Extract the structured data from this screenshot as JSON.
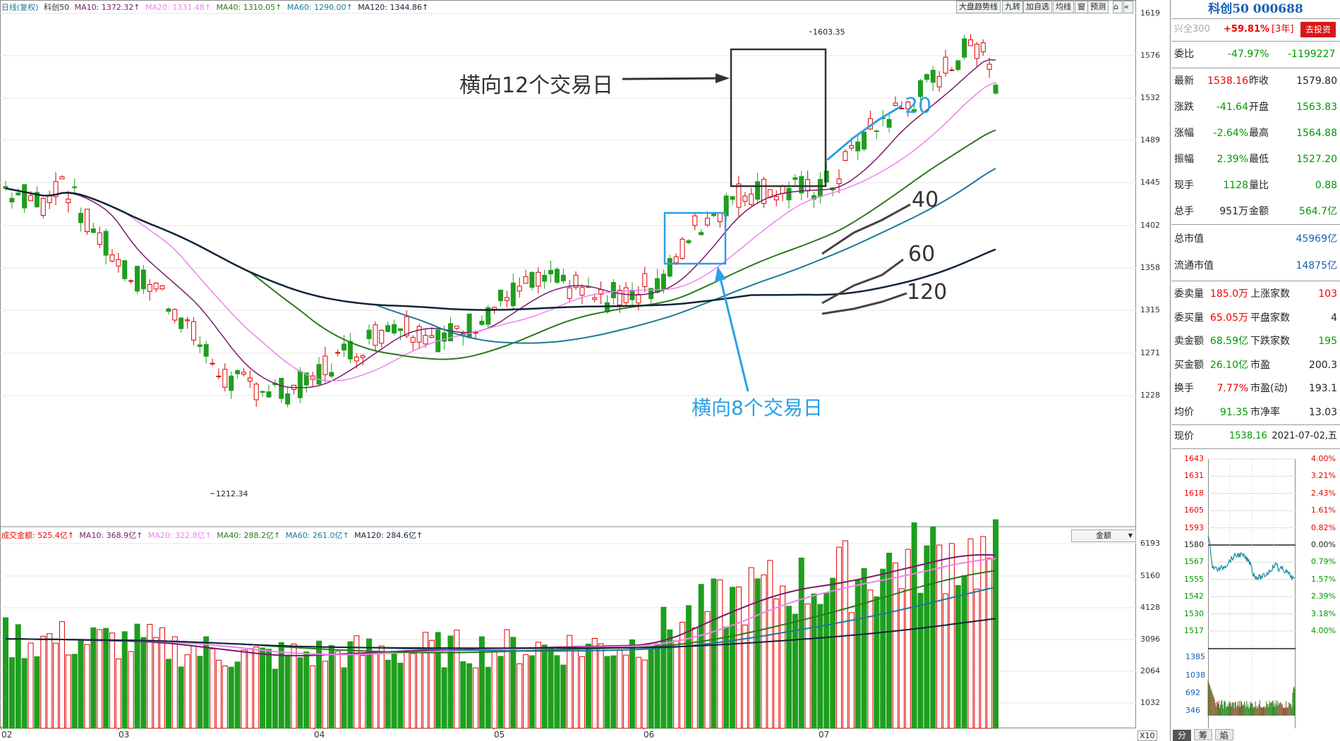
{
  "header_legend": {
    "label_period": "日线(复权)",
    "label_name": "科创50",
    "ma10": "MA10: 1372.32↑",
    "ma20": "MA20: 1331.48↑",
    "ma40": "MA40: 1310.05↑",
    "ma60": "MA60: 1290.00↑",
    "ma120": "MA120: 1344.86↑"
  },
  "toolbar": {
    "trend_label": "大盘趋势线",
    "nine_label": "九转",
    "add_label": "加自选",
    "line_label": "均线",
    "window_label": "窗",
    "forecast_label": "预测"
  },
  "price_axis": [
    "1619",
    "1576",
    "1532",
    "1489",
    "1445",
    "1402",
    "1358",
    "1315",
    "1271",
    "1228"
  ],
  "volume_axis": [
    "6193",
    "5160",
    "4128",
    "3096",
    "2064",
    "1032"
  ],
  "month_axis": [
    "02",
    "03",
    "04",
    "05",
    "06",
    "07"
  ],
  "x10_label": "X10",
  "volume_legend": {
    "title": "成交金额: 525.4亿↑",
    "ma10": "MA10: 368.9亿↑",
    "ma20": "MA20: 322.8亿↑",
    "ma40": "MA40: 288.2亿↑",
    "ma60": "MA60: 261.0亿↑",
    "ma120": "MA120: 284.6亿↑",
    "selector": "金额"
  },
  "annotations": {
    "high_price": "1603.35",
    "low_price": "1212.34",
    "box12": "横向12个交易日",
    "box8": "横向8个交易日",
    "ma20_tag": "20",
    "ma40_tag": "40",
    "ma60_tag": "60",
    "ma120_tag": "120"
  },
  "colors": {
    "up": "#e00000",
    "down": "#1f9e1f",
    "ma10": "#7a1a6a",
    "ma20": "#ee82ee",
    "ma40": "#2a7a1a",
    "ma60": "#1a7a9a",
    "ma120": "#12243a",
    "annot_blue": "#2aa0e6",
    "annot_dark": "#333333"
  },
  "right_panel": {
    "title": "科创50 000688",
    "bench_label": "兴全300",
    "bench_pct": "+59.81%",
    "bench_period": "[3年]",
    "invest_button": "去投资",
    "webi": {
      "label": "委比",
      "pct": "-47.97%",
      "val": "-1199227"
    },
    "quote": [
      {
        "l1": "最新",
        "v1": "1538.16",
        "l2": "昨收",
        "v2": "1579.80",
        "c1": "red",
        "c2": "blk"
      },
      {
        "l1": "涨跌",
        "v1": "-41.64",
        "l2": "开盘",
        "v2": "1563.83",
        "c1": "grn",
        "c2": "grn"
      },
      {
        "l1": "涨幅",
        "v1": "-2.64%",
        "l2": "最高",
        "v2": "1564.88",
        "c1": "grn",
        "c2": "grn"
      },
      {
        "l1": "振幅",
        "v1": "2.39%",
        "l2": "最低",
        "v2": "1527.20",
        "c1": "grn",
        "c2": "grn"
      },
      {
        "l1": "现手",
        "v1": "1128",
        "l2": "量比",
        "v2": "0.88",
        "c1": "grn",
        "c2": "grn"
      },
      {
        "l1": "总手",
        "v1": "951万",
        "l2": "金额",
        "v2": "564.7亿",
        "c1": "blk",
        "c2": "grn"
      }
    ],
    "market_cap": {
      "label": "总市值",
      "val": "45969亿"
    },
    "float_cap": {
      "label": "流通市值",
      "val": "14875亿"
    },
    "depth": [
      {
        "l1": "委卖量",
        "v1": "185.0万",
        "l2": "上涨家数",
        "v2": "103",
        "c1": "red",
        "c2": "red"
      },
      {
        "l1": "委买量",
        "v1": "65.05万",
        "l2": "平盘家数",
        "v2": "4",
        "c1": "red",
        "c2": "blk"
      },
      {
        "l1": "卖金额",
        "v1": "68.59亿",
        "l2": "下跌家数",
        "v2": "195",
        "c1": "grn",
        "c2": "grn"
      },
      {
        "l1": "买金额",
        "v1": "26.10亿",
        "l2": "市盈",
        "v2": "200.3",
        "c1": "grn",
        "c2": "blk"
      },
      {
        "l1": "换手",
        "v1": "7.77%",
        "l2": "市盈(动)",
        "v2": "193.1",
        "c1": "red",
        "c2": "blk"
      },
      {
        "l1": "均价",
        "v1": "91.35",
        "l2": "市净率",
        "v2": "13.03",
        "c1": "grn",
        "c2": "blk"
      }
    ],
    "current": {
      "label": "现价",
      "price": "1538.16",
      "date": "2021-07-02,五"
    },
    "mini_left": [
      "1643",
      "1631",
      "1618",
      "1605",
      "1593",
      "1580",
      "1567",
      "1555",
      "1542",
      "1530",
      "1517"
    ],
    "mini_right": [
      "4.00%",
      "3.21%",
      "2.43%",
      "1.61%",
      "0.82%",
      "0.00%",
      "0.79%",
      "1.57%",
      "2.39%",
      "3.18%",
      "4.00%"
    ],
    "mini_vol": [
      "1385",
      "1038",
      "692",
      "346"
    ],
    "tabs": [
      "分",
      "筹",
      "焰"
    ]
  }
}
